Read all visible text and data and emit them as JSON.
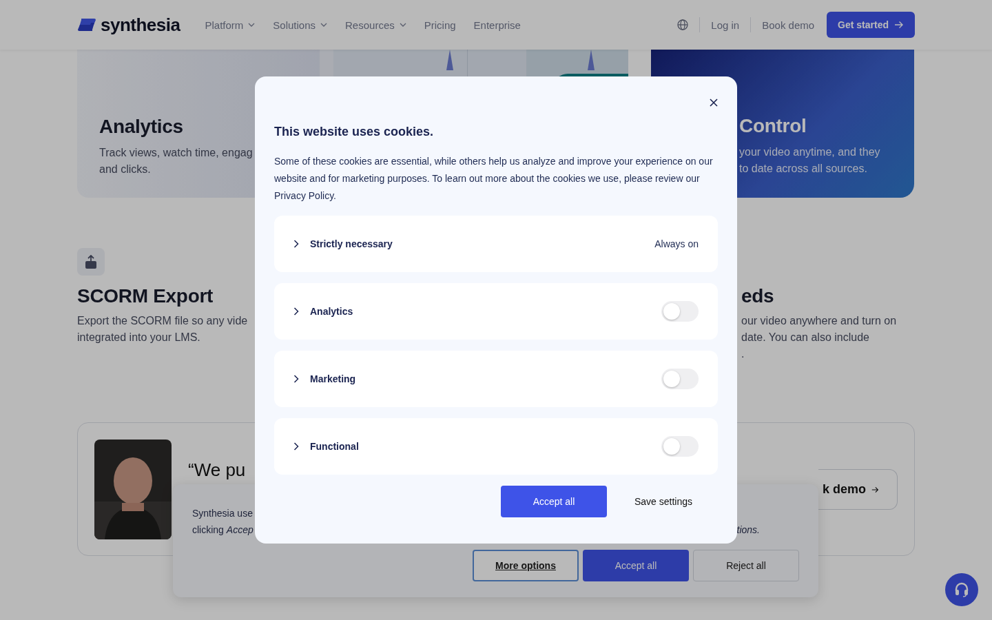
{
  "header": {
    "logo": "synthesia",
    "nav": [
      {
        "label": "Platform",
        "kind": "dropdown"
      },
      {
        "label": "Solutions",
        "kind": "dropdown"
      },
      {
        "label": "Resources",
        "kind": "dropdown"
      },
      {
        "label": "Pricing",
        "kind": "link"
      },
      {
        "label": "Enterprise",
        "kind": "link"
      }
    ],
    "login": "Log in",
    "book_demo": "Book demo",
    "cta": "Get started"
  },
  "top_cards": [
    {
      "kind": "light",
      "title": "Analytics",
      "lines": [
        "Track views, watch time, engag",
        "and clicks."
      ]
    },
    {
      "kind": "picture"
    },
    {
      "kind": "dark",
      "title": "Control",
      "lines": [
        "your video anytime, and they",
        "to date across all sources."
      ]
    }
  ],
  "features": [
    {
      "kind": "icon",
      "title": "SCORM Export",
      "lines": [
        "Export the SCORM file so any vide",
        "integrated into your LMS."
      ]
    },
    {
      "kind": "plain",
      "title": "eds",
      "lines": [
        "our video anywhere and turn on",
        "date. You can also include",
        "."
      ]
    }
  ],
  "testimonial": {
    "quote": "“We pu",
    "button": "k demo"
  },
  "banner": {
    "lines": [
      "Synthesia use",
      "clicking *Accep*"
    ],
    "tail": "tions.",
    "buttons": [
      {
        "label": "More options",
        "kind": "outline"
      },
      {
        "label": "Accept all",
        "kind": "primary"
      },
      {
        "label": "Reject all",
        "kind": "secondary"
      }
    ]
  },
  "modal": {
    "title": "This website uses cookies.",
    "text": "Some of these cookies are essential, while others help us analyze and improve your experience on our website and for marketing purposes. To learn out more about the cookies we use, please review our Privacy Policy.",
    "categories": [
      {
        "label": "Strictly necessary",
        "kind": "status",
        "status": "Always on"
      },
      {
        "label": "Analytics",
        "kind": "toggle",
        "on": false
      },
      {
        "label": "Marketing",
        "kind": "toggle",
        "on": false
      },
      {
        "label": "Functional",
        "kind": "toggle",
        "on": false
      }
    ],
    "accept": "Accept all",
    "save": "Save settings"
  }
}
